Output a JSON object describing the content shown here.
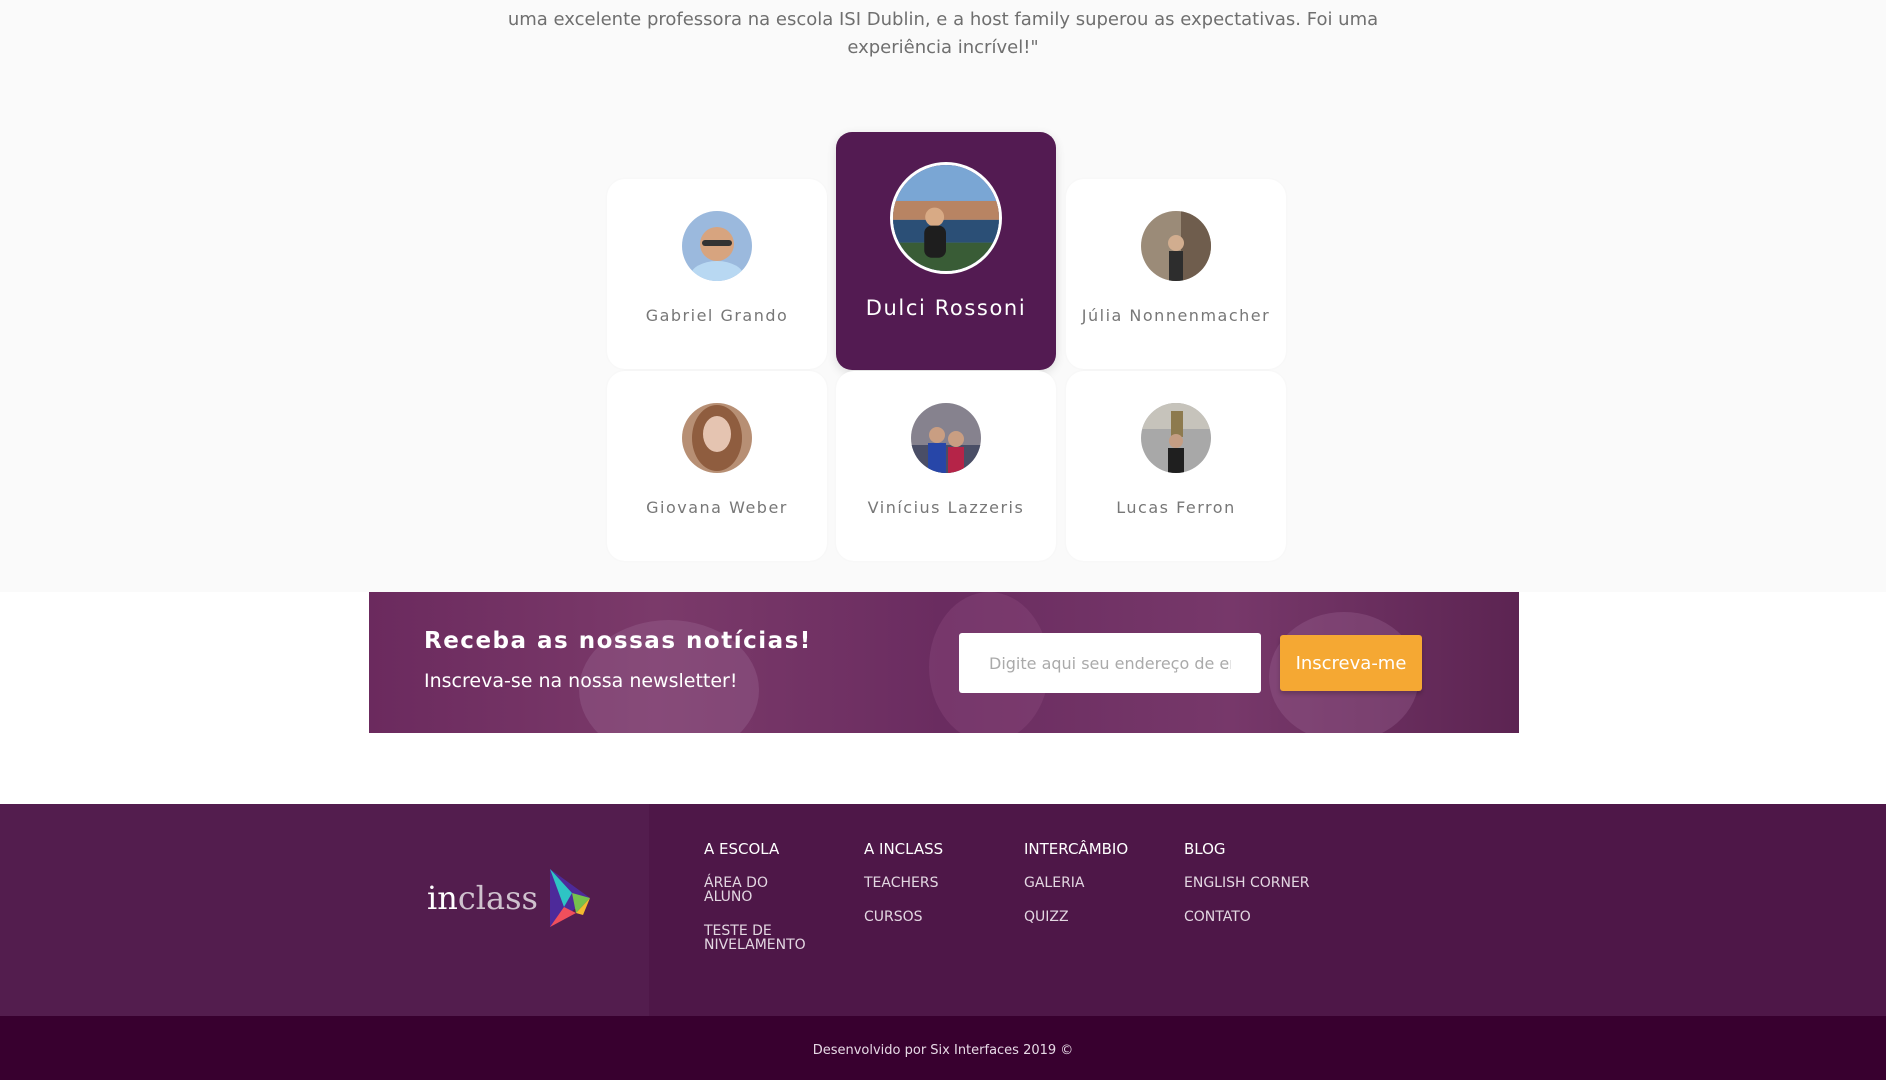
{
  "testimonial": {
    "quote": "uma excelente professora na escola ISI Dublin, e a host family superou as expectativas. Foi uma experiência incrível!\""
  },
  "students": [
    {
      "name": "Gabriel Grando",
      "photo": "gabriel-photo"
    },
    {
      "name": "Dulci Rossoni",
      "photo": "dulci-photo",
      "active": true
    },
    {
      "name": "Júlia Nonnenmacher",
      "photo": "julia-photo"
    },
    {
      "name": "Giovana Weber",
      "photo": "giovana-photo"
    },
    {
      "name": "Vinícius Lazzeris",
      "photo": "vinicius-photo"
    },
    {
      "name": "Lucas Ferron",
      "photo": "lucas-photo"
    }
  ],
  "newsletter": {
    "title": "Receba as nossas notícias!",
    "subtitle": "Inscreva-se na nossa newsletter!",
    "input_placeholder": "Digite aqui seu endereço de email",
    "button_label": "Inscreva-me",
    "accent": "#f5a833"
  },
  "footer": {
    "logo": {
      "in": "in",
      "class": "class"
    },
    "columns": [
      {
        "items": [
          "A ESCOLA",
          "ÁREA DO ALUNO",
          "TESTE DE NIVELAMENTO"
        ]
      },
      {
        "items": [
          "A INCLASS",
          "TEACHERS",
          "CURSOS"
        ]
      },
      {
        "items": [
          "INTERCÂMBIO",
          "GALERIA",
          "QUIZZ"
        ]
      },
      {
        "items": [
          "BLOG",
          "ENGLISH CORNER",
          "CONTATO"
        ]
      }
    ],
    "credits": "Desenvolvido por Six Interfaces 2019 ©"
  },
  "colors": {
    "brand_purple": "#531b52",
    "footer_dark": "#38002f",
    "page_background": "#fafafa"
  }
}
